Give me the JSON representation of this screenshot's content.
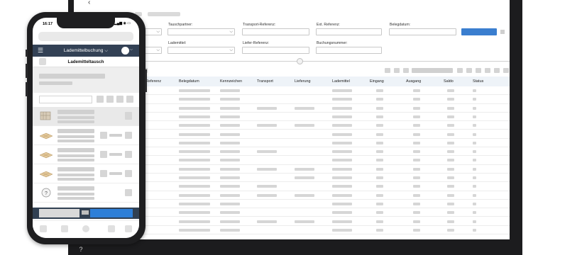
{
  "desktop": {
    "back_icon": "chevron-left-icon",
    "filters": {
      "labels": [
        "Tauschpartner:",
        "Transport-Referenz:",
        "Ext. Referenz:",
        "Belegdatum:",
        "Lademittel:",
        "Liefer-Referenz:",
        "Buchungsnummer:"
      ]
    },
    "table": {
      "headers": [
        "xt. Referenz",
        "Belegdatum",
        "Kennzeichen",
        "Transport",
        "Lieferung",
        "Lademittel",
        "Eingang",
        "Ausgang",
        "Saldo",
        "Status"
      ],
      "row_count": 17
    },
    "bottom_icon": "help-icon"
  },
  "phone": {
    "time": "16:17",
    "status": "▂▄▆ ◉ ▭",
    "app_title": "Lademittelbuchung ⌵",
    "menu_icon": "hamburger-icon",
    "page_title": "Lademitteltausch",
    "items": [
      {
        "icon": "gitterbox-icon"
      },
      {
        "icon": "euro-pallet-icon"
      },
      {
        "icon": "euro-pallet-icon"
      },
      {
        "icon": "euro-pallet-icon"
      },
      {
        "icon": "unknown-item-icon"
      }
    ],
    "accent_color": "#2e7fd8",
    "appbar_color": "#334155"
  }
}
